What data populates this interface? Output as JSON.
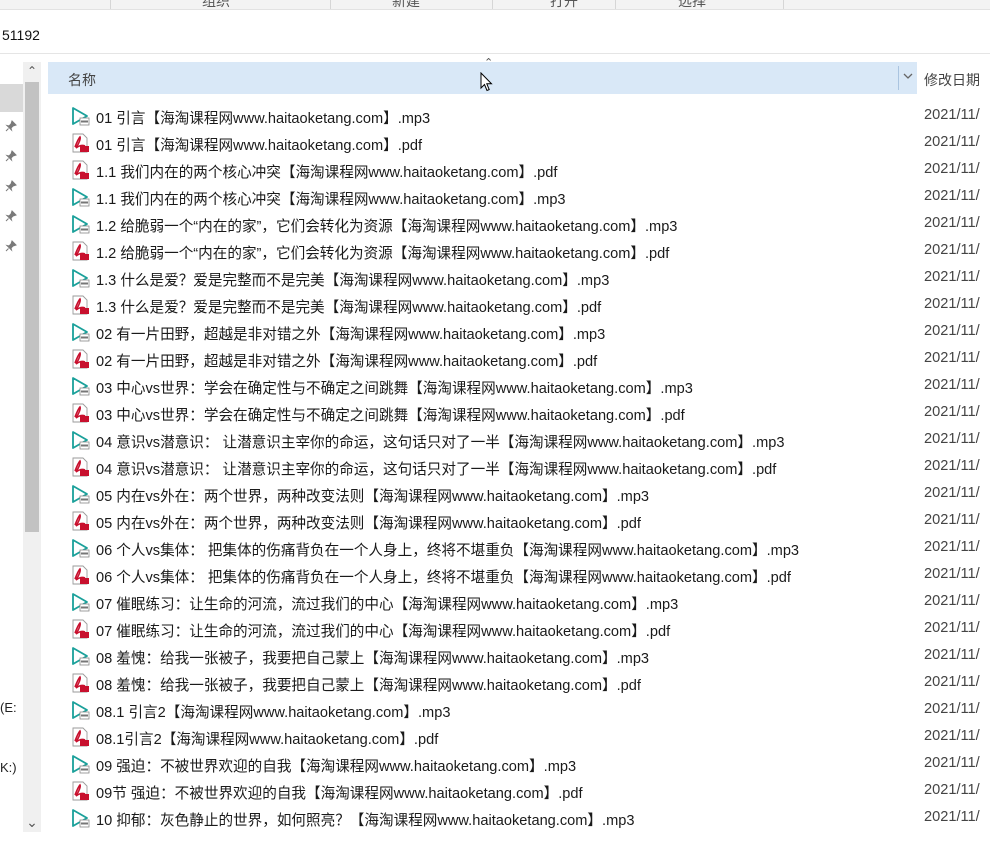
{
  "ribbon": {
    "labels": [
      "组织",
      "新建",
      "打开",
      "选择"
    ]
  },
  "address": {
    "path_fragment": "51192"
  },
  "nav_pane": {
    "fragments": [
      "(E:",
      "K:)"
    ]
  },
  "columns": {
    "name": "名称",
    "modified": "修改日期"
  },
  "files": [
    {
      "name": "01 引言【海淘课程网www.haitaoketang.com】.mp3",
      "type": "mp3",
      "date": "2021/11/"
    },
    {
      "name": "01 引言【海淘课程网www.haitaoketang.com】.pdf",
      "type": "pdf",
      "date": "2021/11/"
    },
    {
      "name": "1.1  我们内在的两个核心冲突【海淘课程网www.haitaoketang.com】.pdf",
      "type": "pdf",
      "date": "2021/11/"
    },
    {
      "name": "1.1 我们内在的两个核心冲突【海淘课程网www.haitaoketang.com】.mp3",
      "type": "mp3",
      "date": "2021/11/"
    },
    {
      "name": "1.2 给脆弱一个“内在的家”，它们会转化为资源【海淘课程网www.haitaoketang.com】.mp3",
      "type": "mp3",
      "date": "2021/11/"
    },
    {
      "name": "1.2 给脆弱一个“内在的家”，它们会转化为资源【海淘课程网www.haitaoketang.com】.pdf",
      "type": "pdf",
      "date": "2021/11/"
    },
    {
      "name": "1.3 什么是爱？爱是完整而不是完美【海淘课程网www.haitaoketang.com】.mp3",
      "type": "mp3",
      "date": "2021/11/"
    },
    {
      "name": "1.3 什么是爱？爱是完整而不是完美【海淘课程网www.haitaoketang.com】.pdf",
      "type": "pdf",
      "date": "2021/11/"
    },
    {
      "name": "02 有一片田野，超越是非对错之外【海淘课程网www.haitaoketang.com】.mp3",
      "type": "mp3",
      "date": "2021/11/"
    },
    {
      "name": "02 有一片田野，超越是非对错之外【海淘课程网www.haitaoketang.com】.pdf",
      "type": "pdf",
      "date": "2021/11/"
    },
    {
      "name": "03 中心vs世界：学会在确定性与不确定之间跳舞【海淘课程网www.haitaoketang.com】.mp3",
      "type": "mp3",
      "date": "2021/11/"
    },
    {
      "name": "03 中心vs世界：学会在确定性与不确定之间跳舞【海淘课程网www.haitaoketang.com】.pdf",
      "type": "pdf",
      "date": "2021/11/"
    },
    {
      "name": "04 意识vs潜意识： 让潜意识主宰你的命运，这句话只对了一半【海淘课程网www.haitaoketang.com】.mp3",
      "type": "mp3",
      "date": "2021/11/"
    },
    {
      "name": "04 意识vs潜意识： 让潜意识主宰你的命运，这句话只对了一半【海淘课程网www.haitaoketang.com】.pdf",
      "type": "pdf",
      "date": "2021/11/"
    },
    {
      "name": "05 内在vs外在：两个世界，两种改变法则【海淘课程网www.haitaoketang.com】.mp3",
      "type": "mp3",
      "date": "2021/11/"
    },
    {
      "name": "05 内在vs外在：两个世界，两种改变法则【海淘课程网www.haitaoketang.com】.pdf",
      "type": "pdf",
      "date": "2021/11/"
    },
    {
      "name": "06 个人vs集体： 把集体的伤痛背负在一个人身上，终将不堪重负【海淘课程网www.haitaoketang.com】.mp3",
      "type": "mp3",
      "date": "2021/11/"
    },
    {
      "name": "06 个人vs集体： 把集体的伤痛背负在一个人身上，终将不堪重负【海淘课程网www.haitaoketang.com】.pdf",
      "type": "pdf",
      "date": "2021/11/"
    },
    {
      "name": "07 催眠练习：让生命的河流，流过我们的中心【海淘课程网www.haitaoketang.com】.mp3",
      "type": "mp3",
      "date": "2021/11/"
    },
    {
      "name": "07 催眠练习：让生命的河流，流过我们的中心【海淘课程网www.haitaoketang.com】.pdf",
      "type": "pdf",
      "date": "2021/11/"
    },
    {
      "name": "08 羞愧：给我一张被子，我要把自己蒙上【海淘课程网www.haitaoketang.com】.mp3",
      "type": "mp3",
      "date": "2021/11/"
    },
    {
      "name": "08 羞愧：给我一张被子，我要把自己蒙上【海淘课程网www.haitaoketang.com】.pdf",
      "type": "pdf",
      "date": "2021/11/"
    },
    {
      "name": "08.1 引言2【海淘课程网www.haitaoketang.com】.mp3",
      "type": "mp3",
      "date": "2021/11/"
    },
    {
      "name": "08.1引言2【海淘课程网www.haitaoketang.com】.pdf",
      "type": "pdf",
      "date": "2021/11/"
    },
    {
      "name": "09 强迫：不被世界欢迎的自我【海淘课程网www.haitaoketang.com】.mp3",
      "type": "mp3",
      "date": "2021/11/"
    },
    {
      "name": "09节 强迫：不被世界欢迎的自我【海淘课程网www.haitaoketang.com】.pdf",
      "type": "pdf",
      "date": "2021/11/"
    },
    {
      "name": "10 抑郁：灰色静止的世界，如何照亮？【海淘课程网www.haitaoketang.com】.mp3",
      "type": "mp3",
      "date": "2021/11/"
    }
  ],
  "colors": {
    "header_bg": "#d9e8f7",
    "mp3_icon": "#1aa09a",
    "pdf_icon": "#c8102e",
    "scroll_thumb": "#c2c2c2"
  }
}
